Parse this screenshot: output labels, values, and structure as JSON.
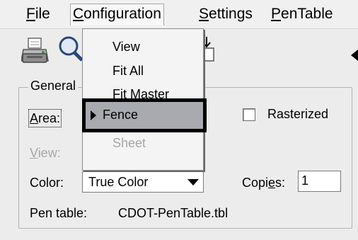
{
  "menubar": {
    "items": [
      {
        "mnemonic": "F",
        "rest": "ile"
      },
      {
        "mnemonic": "C",
        "rest": "onfiguration"
      },
      {
        "mnemonic": "S",
        "rest": "ettings"
      },
      {
        "mnemonic": "P",
        "rest": "enTable"
      }
    ]
  },
  "configuration_menu": {
    "items": [
      "View",
      "Fit All",
      "Fit Master",
      "Fence",
      "Sheet"
    ],
    "selected": "Fence",
    "disabled": [
      "Sheet"
    ]
  },
  "general_group": {
    "title": "General",
    "area_label": "Area:",
    "area_mnemonic": "A",
    "area_rest": "rea:",
    "view_label_m": "V",
    "view_label_rest": "iew:",
    "rasterized_label": "Rasterized",
    "rasterized_checked": false,
    "color_label": "Color:",
    "color_value": "True Color",
    "copies_label_pre": "Copi",
    "copies_label_m": "e",
    "copies_label_post": "s:",
    "copies_value": "1",
    "pen_table_label": "Pen table:",
    "pen_table_value": "CDOT-PenTable.tbl"
  },
  "icons": [
    "printer-icon",
    "preview-icon",
    "tool-icon",
    "arrow-right-icon"
  ]
}
